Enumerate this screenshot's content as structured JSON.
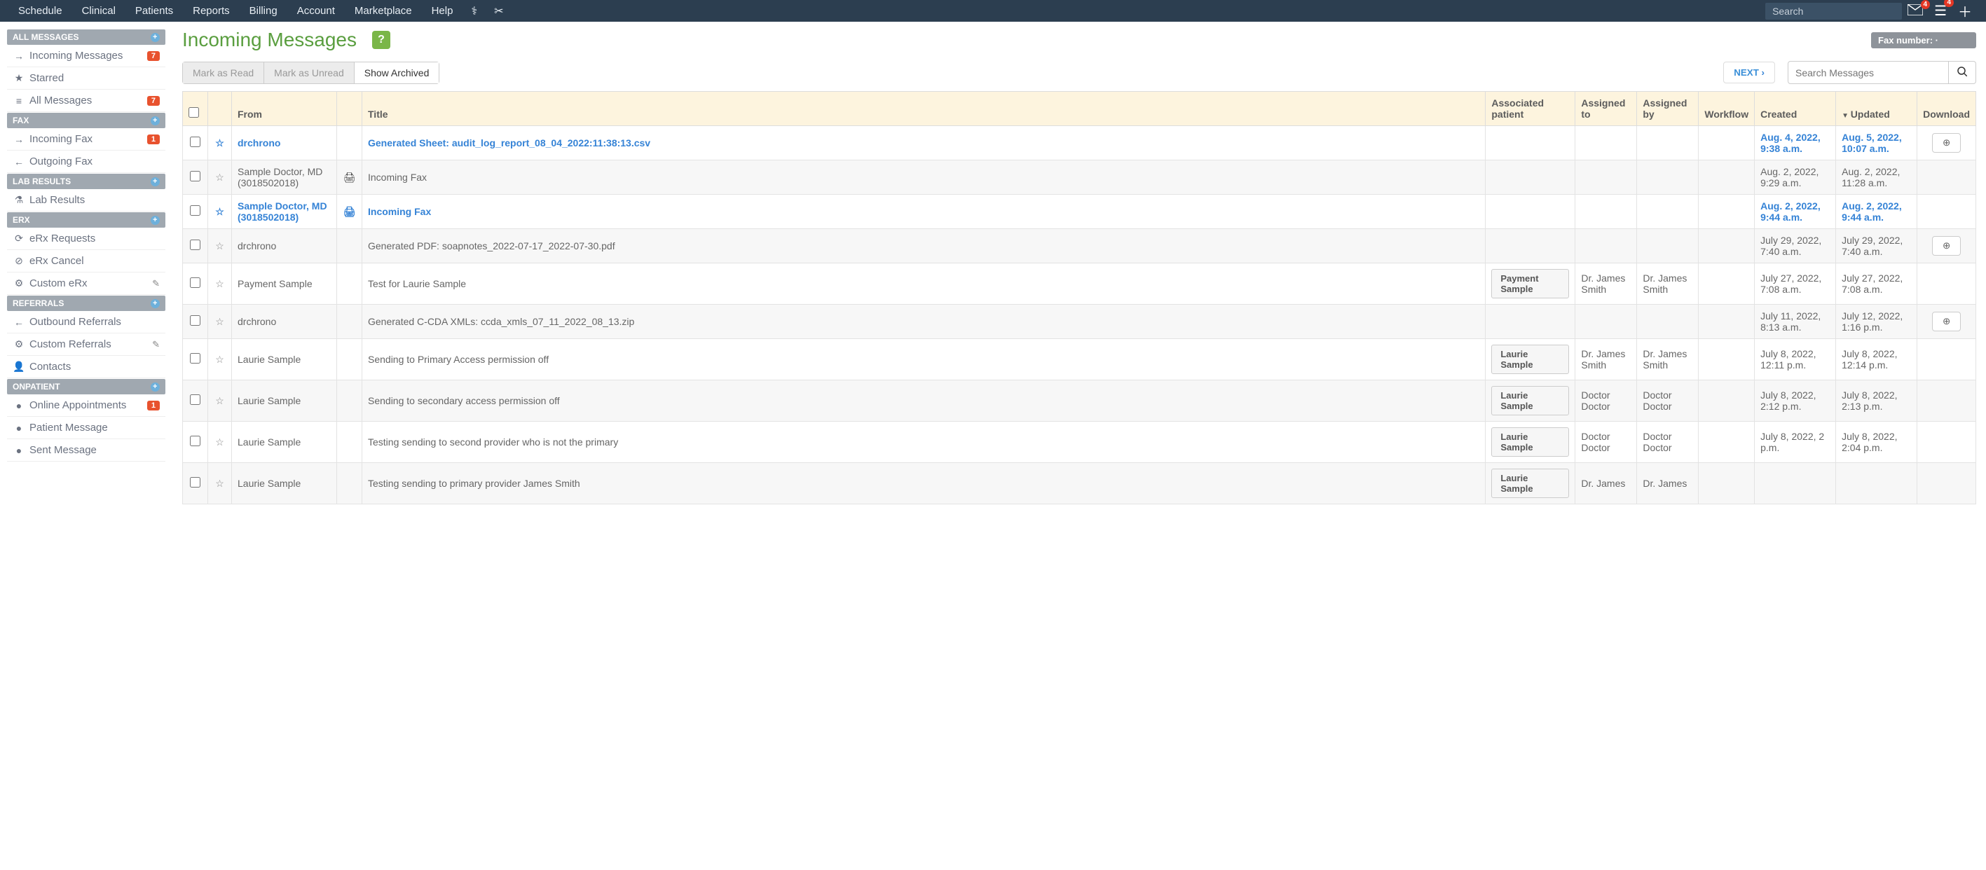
{
  "topnav": {
    "items": [
      "Schedule",
      "Clinical",
      "Patients",
      "Reports",
      "Billing",
      "Account",
      "Marketplace",
      "Help"
    ],
    "search_placeholder": "Search",
    "mail_badge": "4",
    "menu_badge": "4"
  },
  "sidebar": {
    "groups": [
      {
        "header": "ALL MESSAGES",
        "items": [
          {
            "icon": "→",
            "label": "Incoming Messages",
            "count": "7"
          },
          {
            "icon": "★",
            "label": "Starred"
          },
          {
            "icon": "≡",
            "label": "All Messages",
            "count": "7"
          }
        ]
      },
      {
        "header": "FAX",
        "items": [
          {
            "icon": "→",
            "label": "Incoming Fax",
            "count": "1"
          },
          {
            "icon": "←",
            "label": "Outgoing Fax"
          }
        ]
      },
      {
        "header": "LAB RESULTS",
        "items": [
          {
            "icon": "⚗",
            "label": "Lab Results"
          }
        ]
      },
      {
        "header": "ERX",
        "items": [
          {
            "icon": "⟳",
            "label": "eRx Requests"
          },
          {
            "icon": "⊘",
            "label": "eRx Cancel"
          },
          {
            "icon": "⚙",
            "label": "Custom eRx",
            "edit": true
          }
        ]
      },
      {
        "header": "REFERRALS",
        "items": [
          {
            "icon": "←",
            "label": "Outbound Referrals"
          },
          {
            "icon": "⚙",
            "label": "Custom Referrals",
            "edit": true
          },
          {
            "icon": "👤",
            "label": "Contacts"
          }
        ]
      },
      {
        "header": "ONPATIENT",
        "items": [
          {
            "icon": "●",
            "label": "Online Appointments",
            "count": "1"
          },
          {
            "icon": "●",
            "label": "Patient Message"
          },
          {
            "icon": "●",
            "label": "Sent Message"
          }
        ]
      }
    ]
  },
  "header": {
    "title": "Incoming Messages",
    "fax_label": "Fax number: ·"
  },
  "toolbar": {
    "mark_read": "Mark as Read",
    "mark_unread": "Mark as Unread",
    "show_archived": "Show Archived",
    "next": "NEXT",
    "search_placeholder": "Search Messages"
  },
  "table": {
    "headers": {
      "from": "From",
      "title": "Title",
      "associated_patient": "Associated patient",
      "assigned_to": "Assigned to",
      "assigned_by": "Assigned by",
      "workflow": "Workflow",
      "created": "Created",
      "updated": "Updated",
      "download": "Download"
    },
    "rows": [
      {
        "unread": true,
        "from": "drchrono",
        "print": false,
        "title": "Generated Sheet: audit_log_report_08_04_2022:11:38:13.csv",
        "patient": "",
        "assigned_to": "",
        "assigned_by": "",
        "workflow": "",
        "created": "Aug. 4, 2022, 9:38 a.m.",
        "updated": "Aug. 5, 2022, 10:07 a.m.",
        "download": true
      },
      {
        "unread": false,
        "from": "Sample Doctor, MD (3018502018)",
        "print": true,
        "title": "Incoming Fax",
        "patient": "",
        "assigned_to": "",
        "assigned_by": "",
        "workflow": "",
        "created": "Aug. 2, 2022, 9:29 a.m.",
        "updated": "Aug. 2, 2022, 11:28 a.m.",
        "download": false
      },
      {
        "unread": true,
        "from": "Sample Doctor, MD (3018502018)",
        "print": true,
        "title": "Incoming Fax",
        "patient": "",
        "assigned_to": "",
        "assigned_by": "",
        "workflow": "",
        "created": "Aug. 2, 2022, 9:44 a.m.",
        "updated": "Aug. 2, 2022, 9:44 a.m.",
        "download": false
      },
      {
        "unread": false,
        "from": "drchrono",
        "print": false,
        "title": "Generated PDF: soapnotes_2022-07-17_2022-07-30.pdf",
        "patient": "",
        "assigned_to": "",
        "assigned_by": "",
        "workflow": "",
        "created": "July 29, 2022, 7:40 a.m.",
        "updated": "July 29, 2022, 7:40 a.m.",
        "download": true
      },
      {
        "unread": false,
        "from": "Payment Sample",
        "print": false,
        "title": "Test for Laurie Sample",
        "patient": "Payment Sample",
        "assigned_to": "Dr. James Smith",
        "assigned_by": "Dr. James Smith",
        "workflow": "",
        "created": "July 27, 2022, 7:08 a.m.",
        "updated": "July 27, 2022, 7:08 a.m.",
        "download": false
      },
      {
        "unread": false,
        "from": "drchrono",
        "print": false,
        "title": "Generated C-CDA XMLs: ccda_xmls_07_11_2022_08_13.zip",
        "patient": "",
        "assigned_to": "",
        "assigned_by": "",
        "workflow": "",
        "created": "July 11, 2022, 8:13 a.m.",
        "updated": "July 12, 2022, 1:16 p.m.",
        "download": true
      },
      {
        "unread": false,
        "from": "Laurie Sample",
        "print": false,
        "title": "Sending to Primary Access permission off",
        "patient": "Laurie Sample",
        "assigned_to": "Dr. James Smith",
        "assigned_by": "Dr. James Smith",
        "workflow": "",
        "created": "July 8, 2022, 12:11 p.m.",
        "updated": "July 8, 2022, 12:14 p.m.",
        "download": false
      },
      {
        "unread": false,
        "from": "Laurie Sample",
        "print": false,
        "title": "Sending to secondary access permission off",
        "patient": "Laurie Sample",
        "assigned_to": "Doctor Doctor",
        "assigned_by": "Doctor Doctor",
        "workflow": "",
        "created": "July 8, 2022, 2:12 p.m.",
        "updated": "July 8, 2022, 2:13 p.m.",
        "download": false
      },
      {
        "unread": false,
        "from": "Laurie Sample",
        "print": false,
        "title": "Testing sending to second provider who is not the primary",
        "patient": "Laurie Sample",
        "assigned_to": "Doctor Doctor",
        "assigned_by": "Doctor Doctor",
        "workflow": "",
        "created": "July 8, 2022, 2 p.m.",
        "updated": "July 8, 2022, 2:04 p.m.",
        "download": false
      },
      {
        "unread": false,
        "from": "Laurie Sample",
        "print": false,
        "title": "Testing sending to primary provider James Smith",
        "patient": "Laurie Sample",
        "assigned_to": "Dr. James",
        "assigned_by": "Dr. James",
        "workflow": "",
        "created": "",
        "updated": "",
        "download": false
      }
    ]
  }
}
